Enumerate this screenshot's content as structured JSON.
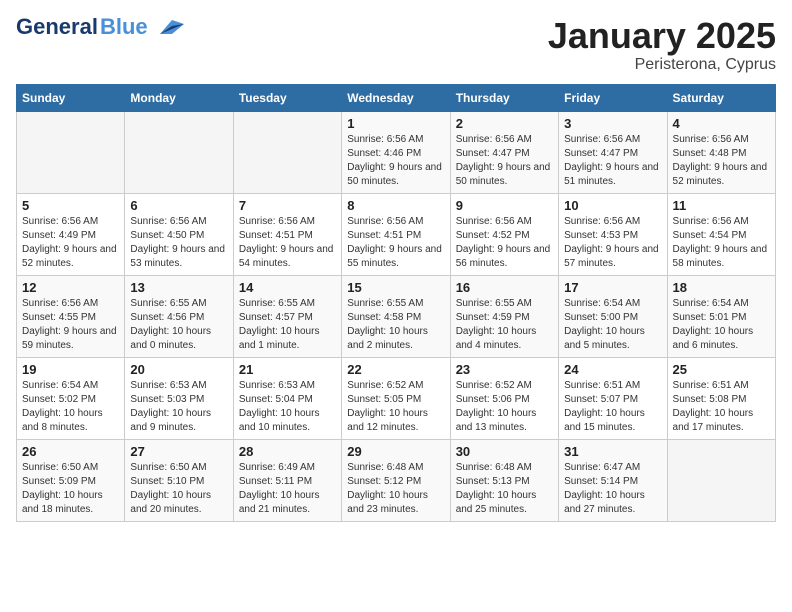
{
  "header": {
    "logo_general": "General",
    "logo_blue": "Blue",
    "title": "January 2025",
    "subtitle": "Peristerona, Cyprus"
  },
  "weekdays": [
    "Sunday",
    "Monday",
    "Tuesday",
    "Wednesday",
    "Thursday",
    "Friday",
    "Saturday"
  ],
  "weeks": [
    [
      {
        "num": "",
        "info": ""
      },
      {
        "num": "",
        "info": ""
      },
      {
        "num": "",
        "info": ""
      },
      {
        "num": "1",
        "info": "Sunrise: 6:56 AM\nSunset: 4:46 PM\nDaylight: 9 hours\nand 50 minutes."
      },
      {
        "num": "2",
        "info": "Sunrise: 6:56 AM\nSunset: 4:47 PM\nDaylight: 9 hours\nand 50 minutes."
      },
      {
        "num": "3",
        "info": "Sunrise: 6:56 AM\nSunset: 4:47 PM\nDaylight: 9 hours\nand 51 minutes."
      },
      {
        "num": "4",
        "info": "Sunrise: 6:56 AM\nSunset: 4:48 PM\nDaylight: 9 hours\nand 52 minutes."
      }
    ],
    [
      {
        "num": "5",
        "info": "Sunrise: 6:56 AM\nSunset: 4:49 PM\nDaylight: 9 hours\nand 52 minutes."
      },
      {
        "num": "6",
        "info": "Sunrise: 6:56 AM\nSunset: 4:50 PM\nDaylight: 9 hours\nand 53 minutes."
      },
      {
        "num": "7",
        "info": "Sunrise: 6:56 AM\nSunset: 4:51 PM\nDaylight: 9 hours\nand 54 minutes."
      },
      {
        "num": "8",
        "info": "Sunrise: 6:56 AM\nSunset: 4:51 PM\nDaylight: 9 hours\nand 55 minutes."
      },
      {
        "num": "9",
        "info": "Sunrise: 6:56 AM\nSunset: 4:52 PM\nDaylight: 9 hours\nand 56 minutes."
      },
      {
        "num": "10",
        "info": "Sunrise: 6:56 AM\nSunset: 4:53 PM\nDaylight: 9 hours\nand 57 minutes."
      },
      {
        "num": "11",
        "info": "Sunrise: 6:56 AM\nSunset: 4:54 PM\nDaylight: 9 hours\nand 58 minutes."
      }
    ],
    [
      {
        "num": "12",
        "info": "Sunrise: 6:56 AM\nSunset: 4:55 PM\nDaylight: 9 hours\nand 59 minutes."
      },
      {
        "num": "13",
        "info": "Sunrise: 6:55 AM\nSunset: 4:56 PM\nDaylight: 10 hours\nand 0 minutes."
      },
      {
        "num": "14",
        "info": "Sunrise: 6:55 AM\nSunset: 4:57 PM\nDaylight: 10 hours\nand 1 minute."
      },
      {
        "num": "15",
        "info": "Sunrise: 6:55 AM\nSunset: 4:58 PM\nDaylight: 10 hours\nand 2 minutes."
      },
      {
        "num": "16",
        "info": "Sunrise: 6:55 AM\nSunset: 4:59 PM\nDaylight: 10 hours\nand 4 minutes."
      },
      {
        "num": "17",
        "info": "Sunrise: 6:54 AM\nSunset: 5:00 PM\nDaylight: 10 hours\nand 5 minutes."
      },
      {
        "num": "18",
        "info": "Sunrise: 6:54 AM\nSunset: 5:01 PM\nDaylight: 10 hours\nand 6 minutes."
      }
    ],
    [
      {
        "num": "19",
        "info": "Sunrise: 6:54 AM\nSunset: 5:02 PM\nDaylight: 10 hours\nand 8 minutes."
      },
      {
        "num": "20",
        "info": "Sunrise: 6:53 AM\nSunset: 5:03 PM\nDaylight: 10 hours\nand 9 minutes."
      },
      {
        "num": "21",
        "info": "Sunrise: 6:53 AM\nSunset: 5:04 PM\nDaylight: 10 hours\nand 10 minutes."
      },
      {
        "num": "22",
        "info": "Sunrise: 6:52 AM\nSunset: 5:05 PM\nDaylight: 10 hours\nand 12 minutes."
      },
      {
        "num": "23",
        "info": "Sunrise: 6:52 AM\nSunset: 5:06 PM\nDaylight: 10 hours\nand 13 minutes."
      },
      {
        "num": "24",
        "info": "Sunrise: 6:51 AM\nSunset: 5:07 PM\nDaylight: 10 hours\nand 15 minutes."
      },
      {
        "num": "25",
        "info": "Sunrise: 6:51 AM\nSunset: 5:08 PM\nDaylight: 10 hours\nand 17 minutes."
      }
    ],
    [
      {
        "num": "26",
        "info": "Sunrise: 6:50 AM\nSunset: 5:09 PM\nDaylight: 10 hours\nand 18 minutes."
      },
      {
        "num": "27",
        "info": "Sunrise: 6:50 AM\nSunset: 5:10 PM\nDaylight: 10 hours\nand 20 minutes."
      },
      {
        "num": "28",
        "info": "Sunrise: 6:49 AM\nSunset: 5:11 PM\nDaylight: 10 hours\nand 21 minutes."
      },
      {
        "num": "29",
        "info": "Sunrise: 6:48 AM\nSunset: 5:12 PM\nDaylight: 10 hours\nand 23 minutes."
      },
      {
        "num": "30",
        "info": "Sunrise: 6:48 AM\nSunset: 5:13 PM\nDaylight: 10 hours\nand 25 minutes."
      },
      {
        "num": "31",
        "info": "Sunrise: 6:47 AM\nSunset: 5:14 PM\nDaylight: 10 hours\nand 27 minutes."
      },
      {
        "num": "",
        "info": ""
      }
    ]
  ]
}
